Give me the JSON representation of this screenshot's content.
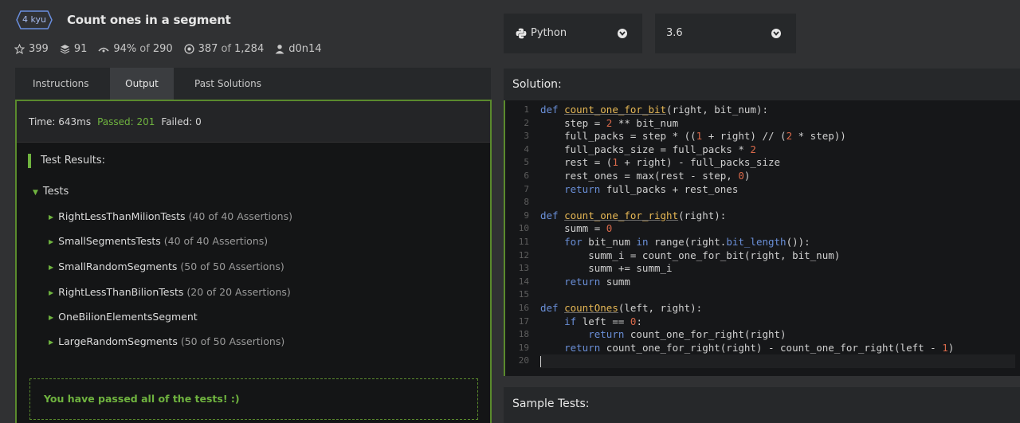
{
  "kata": {
    "rank": "4 kyu",
    "title": "Count ones in a segment"
  },
  "stats": {
    "stars": "399",
    "collections": "91",
    "satisfaction": "94%",
    "satisfaction_sep": "of",
    "satisfaction_total": "290",
    "completed": "387",
    "completed_sep": "of",
    "completed_total": "1,284",
    "author": "d0n14"
  },
  "tabs": [
    "Instructions",
    "Output",
    "Past Solutions"
  ],
  "output": {
    "time": "Time: 643ms",
    "passed": "Passed: 201",
    "failed": "Failed: 0",
    "results_title": "Test Results:",
    "tests_group": "Tests",
    "tests": [
      {
        "name": "RightLessThanMilionTests",
        "meta": "(40 of 40 Assertions)"
      },
      {
        "name": "SmallSegmentsTests",
        "meta": "(40 of 40 Assertions)"
      },
      {
        "name": "SmallRandomSegments",
        "meta": "(50 of 50 Assertions)"
      },
      {
        "name": "RightLessThanBilionTests",
        "meta": "(20 of 20 Assertions)"
      },
      {
        "name": "OneBilionElementsSegment",
        "meta": ""
      },
      {
        "name": "LargeRandomSegments",
        "meta": "(50 of 50 Assertions)"
      }
    ],
    "success_message": "You have passed all of the tests! :)"
  },
  "language": {
    "selected": "Python",
    "icon": "python-icon"
  },
  "version": {
    "selected": "3.6"
  },
  "solution_label": "Solution:",
  "sample_tests_label": "Sample Tests:",
  "line_numbers": [
    "1",
    "2",
    "3",
    "4",
    "5",
    "6",
    "7",
    "8",
    "9",
    "10",
    "11",
    "12",
    "13",
    "14",
    "15",
    "16",
    "17",
    "18",
    "19",
    "20"
  ],
  "colors": {
    "accent_green": "#6fb33f",
    "keyword": "#6a8fd8",
    "function": "#e7b855",
    "number": "#d9694a"
  }
}
